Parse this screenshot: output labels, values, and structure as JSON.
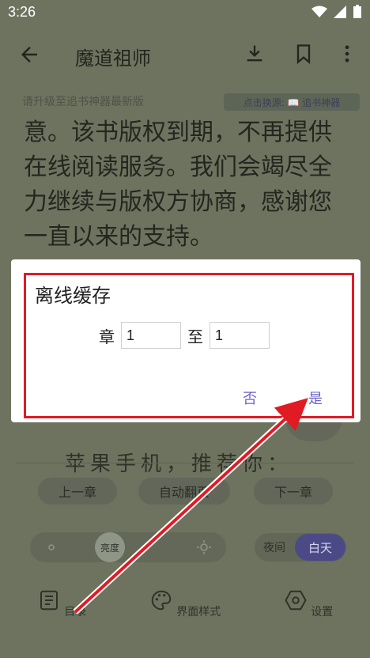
{
  "status_bar": {
    "time": "3:26",
    "icons": [
      "wifi-icon",
      "signal-icon",
      "battery-icon"
    ]
  },
  "app_bar": {
    "title": "魔道祖师",
    "icons": [
      "back-arrow-icon",
      "download-icon",
      "bookmark-icon",
      "more-vert-icon"
    ]
  },
  "notice": {
    "text": "请升级至追书神器最新版",
    "source_label": "点击换源: 📖 追书神器"
  },
  "reader": {
    "lines": [
      "意。该书版权到期，不再提供",
      "在线阅读服务。我们会竭尽全",
      "力继续与版权方协商，感谢您",
      "一直以来的支持。"
    ],
    "partial_line_1": "",
    "partial_line_2": "苹果手机，推荐你："
  },
  "dialog": {
    "title": "离线缓存",
    "from_label": "章",
    "from_value": "1",
    "to_label": "至",
    "to_value": "1",
    "cancel_label": "否",
    "confirm_label": "是"
  },
  "controls": {
    "prev_chapter": "上一章",
    "auto_page": "自动翻页",
    "next_chapter": "下一章",
    "brightness_label": "亮度",
    "night_label": "夜间",
    "day_label": "白天"
  },
  "bottom_nav": [
    {
      "label": "目录",
      "icon": "toc-icon"
    },
    {
      "label": "界面样式",
      "icon": "palette-icon"
    },
    {
      "label": "设置",
      "icon": "settings-icon"
    }
  ],
  "colors": {
    "accent": "#6a61c9",
    "highlight": "#e01b24",
    "day_active": "#4b4a86"
  }
}
